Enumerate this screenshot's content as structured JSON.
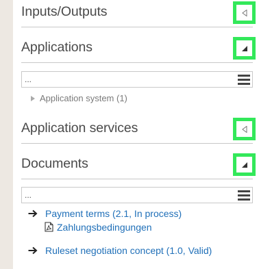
{
  "sections": {
    "inputs_outputs": {
      "title": "Inputs/Outputs",
      "state_icon": "triangle-left-icon"
    },
    "applications": {
      "title": "Applications",
      "state_icon": "corner-triangle-icon",
      "filter_placeholder": "...",
      "items": [
        {
          "label": "Application system (1)",
          "icon": "caret-right-icon"
        }
      ]
    },
    "application_services": {
      "title": "Application services",
      "state_icon": "triangle-left-icon"
    },
    "documents": {
      "title": "Documents",
      "state_icon": "corner-triangle-icon",
      "filter_placeholder": "...",
      "items": [
        {
          "label": "Payment terms (2.1, In process)",
          "icon": "arrow-right-icon"
        },
        {
          "label": "Zahlungsbedingungen",
          "icon": "pdf-file-icon"
        },
        {
          "label": "Ruleset negotiation concept (1.0, Valid)",
          "icon": "arrow-right-icon"
        }
      ]
    }
  },
  "colors": {
    "highlight": "#33e85a",
    "link": "#1f6fb8",
    "background": "#ede8e2"
  }
}
